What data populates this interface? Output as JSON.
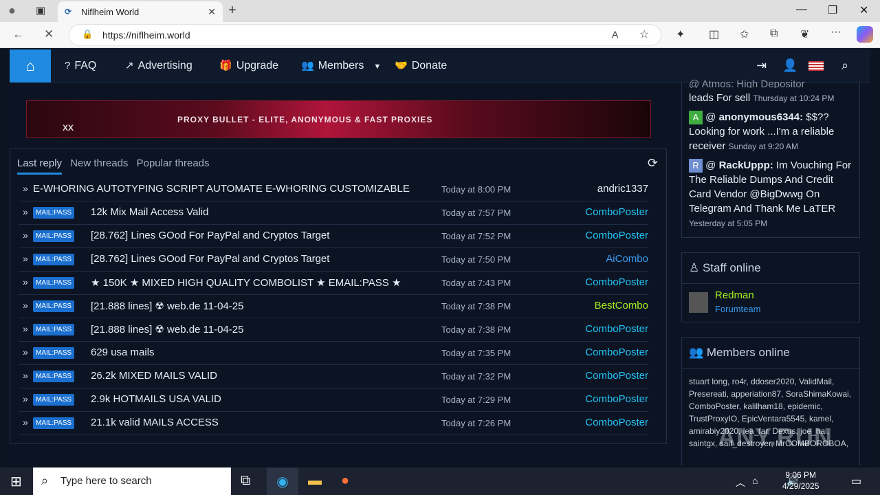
{
  "browser": {
    "tab_title": "Niflheim World",
    "url": "https://niflheim.world",
    "new_tab_glyph": "+"
  },
  "nav": {
    "items": [
      "FAQ",
      "Advertising",
      "Upgrade",
      "Members",
      "Donate"
    ]
  },
  "banner": {
    "left_text": "XX",
    "text": "PROXY BULLET - ELITE, ANONYMOUS & FAST PROXIES"
  },
  "threads": {
    "tabs": [
      "Last reply",
      "New threads",
      "Popular threads"
    ],
    "tag_label": "MAIL:PASS",
    "rows": [
      {
        "title": "E-WHORING AUTOTYPING SCRIPT AUTOMATE E-WHORING CUSTOMIZABLE",
        "time": "Today at 8:00 PM",
        "author": "andric1337",
        "tag": false,
        "color": "#e6ecf4"
      },
      {
        "title": "12k Mix Mail Access Valid",
        "time": "Today at 7:57 PM",
        "author": "ComboPoster",
        "tag": true,
        "color": "#22c5f5"
      },
      {
        "title": "[28.762] Lines GOod For PayPal and Cryptos Target",
        "time": "Today at 7:52 PM",
        "author": "ComboPoster",
        "tag": true,
        "color": "#22c5f5"
      },
      {
        "title": "[28.762] Lines GOod For PayPal and Cryptos Target",
        "time": "Today at 7:50 PM",
        "author": "AiCombo",
        "tag": true,
        "color": "#3a9cf0"
      },
      {
        "title": "★ 150K ★ MIXED HIGH QUALITY COMBOLIST ★ EMAIL:PASS ★",
        "time": "Today at 7:43 PM",
        "author": "ComboPoster",
        "tag": true,
        "color": "#22c5f5"
      },
      {
        "title": "[21.888 lines] ☢ web.de 11-04-25",
        "time": "Today at 7:38 PM",
        "author": "BestCombo",
        "tag": true,
        "color": "#a6f020"
      },
      {
        "title": "[21.888 lines] ☢ web.de 11-04-25",
        "time": "Today at 7:38 PM",
        "author": "ComboPoster",
        "tag": true,
        "color": "#22c5f5"
      },
      {
        "title": "629 usa mails",
        "time": "Today at 7:35 PM",
        "author": "ComboPoster",
        "tag": true,
        "color": "#22c5f5"
      },
      {
        "title": "26.2k MIXED MAILS VALID",
        "time": "Today at 7:32 PM",
        "author": "ComboPoster",
        "tag": true,
        "color": "#22c5f5"
      },
      {
        "title": "2.9k HOTMAILS USA VALID",
        "time": "Today at 7:29 PM",
        "author": "ComboPoster",
        "tag": true,
        "color": "#22c5f5"
      },
      {
        "title": "21.1k valid MAILS ACCESS",
        "time": "Today at 7:26 PM",
        "author": "ComboPoster",
        "tag": true,
        "color": "#22c5f5"
      }
    ]
  },
  "shoutbox": {
    "first_partial": "@ Atmos: High Depositor",
    "first_line": "leads For sell",
    "first_time": "Thursday at 10:24 PM",
    "entries": [
      {
        "avatar": "A",
        "avatar_color": "#3fae3f",
        "user": "anonymous6344:",
        "msg": "$$?? Looking for work ...I'm a reliable receiver",
        "time": "Sunday at 9:20 AM"
      },
      {
        "avatar": "R",
        "avatar_color": "#6f8fd0",
        "user": "RackUppp:",
        "msg": "Im Vouching For The Reliable Dumps And Credit Card Vendor @BigDwwg On Telegram And Thank Me LaTER",
        "time": "Yesterday at 5:05 PM"
      }
    ]
  },
  "staff": {
    "title": "Staff online",
    "name": "Redman",
    "role": "Forumteam"
  },
  "members_online": {
    "title": "Members online",
    "list": "stuart long, ro4r, ddoser2020, ValidMail, Presereati, apperiation87, SoraShimaKowai, ComboPoster, kalilham18, epidemic, TrustProxyIO, EpicVentara5545, kamel, amirabiy2020, lea_far, Dexus, joe_hal, saintgx, saif_destroyer, MrCOMBOROBOA,"
  },
  "watermark": "ANY.RUN",
  "taskbar": {
    "search_placeholder": "Type here to search",
    "time": "9:06 PM",
    "date": "4/29/2025"
  }
}
